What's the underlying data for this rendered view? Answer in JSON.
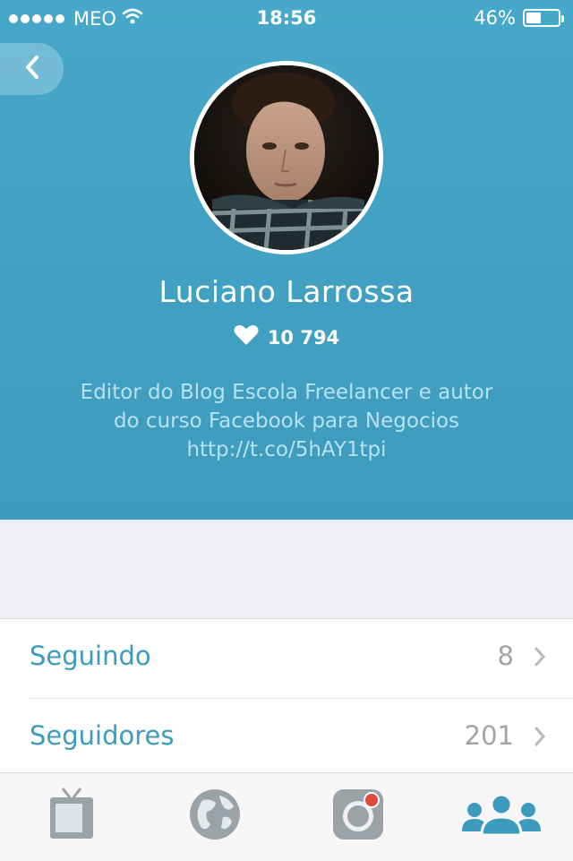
{
  "status_bar": {
    "carrier": "MEO",
    "time": "18:56",
    "battery_percent": "46%",
    "battery_level": 0.46,
    "icons": [
      "signal-dots-icon",
      "wifi-icon",
      "battery-icon"
    ]
  },
  "profile": {
    "name": "Luciano Larrossa",
    "likes": "10 794",
    "bio": "Editor do Blog Escola Freelancer e autor do curso Facebook para Negocios http://t.co/5hAY1tpi"
  },
  "rows": [
    {
      "label": "Seguindo",
      "count": "8"
    },
    {
      "label": "Seguidores",
      "count": "201"
    }
  ],
  "tabbar": {
    "tabs": [
      {
        "icon": "tv-icon",
        "selected": false
      },
      {
        "icon": "globe-icon",
        "selected": false
      },
      {
        "icon": "camera-record-icon",
        "selected": false
      },
      {
        "icon": "people-icon",
        "selected": true
      }
    ]
  },
  "colors": {
    "header": "#429fc2",
    "accent": "#3d9bbd",
    "bio_text": "#b8e1f0",
    "muted": "#a3a3a8",
    "record_red": "#e0483a"
  }
}
